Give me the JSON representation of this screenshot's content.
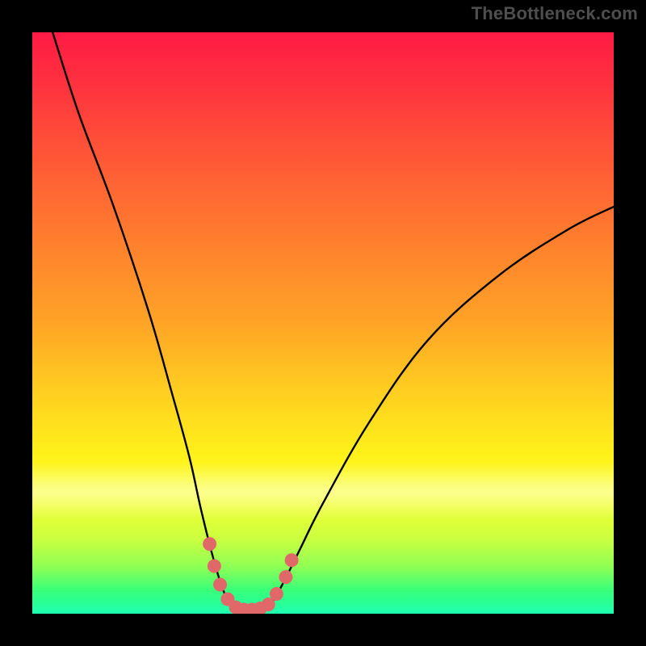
{
  "watermark": "TheBottleneck.com",
  "chart_data": {
    "type": "line",
    "title": "",
    "xlabel": "",
    "ylabel": "",
    "xlim": [
      0,
      100
    ],
    "ylim": [
      0,
      100
    ],
    "series": [
      {
        "name": "bottleneck-curve",
        "x": [
          3.5,
          8,
          14,
          20,
          24,
          27,
          29,
          31,
          32.5,
          34,
          35.5,
          37,
          39,
          41,
          43,
          46,
          50,
          58,
          68,
          80,
          92,
          100
        ],
        "values": [
          100,
          86,
          70,
          52,
          38,
          27,
          18,
          10,
          5,
          1.5,
          0.7,
          0.7,
          0.8,
          1.7,
          5,
          11,
          19,
          33,
          47,
          58,
          66,
          70
        ]
      }
    ],
    "markers": {
      "name": "highlight-dots",
      "color": "#e06868",
      "x": [
        30.5,
        31.3,
        32.3,
        33.6,
        35.0,
        36.4,
        37.8,
        39.2,
        40.6,
        42.0,
        43.6,
        44.6
      ],
      "values": [
        12.0,
        8.2,
        5.0,
        2.5,
        1.1,
        0.7,
        0.7,
        0.9,
        1.6,
        3.4,
        6.3,
        9.2
      ]
    },
    "background_gradient": {
      "top": "#ff1a44",
      "mid1": "#ff7f2e",
      "mid2": "#fff21a",
      "bottom": "#1dffb0"
    }
  }
}
